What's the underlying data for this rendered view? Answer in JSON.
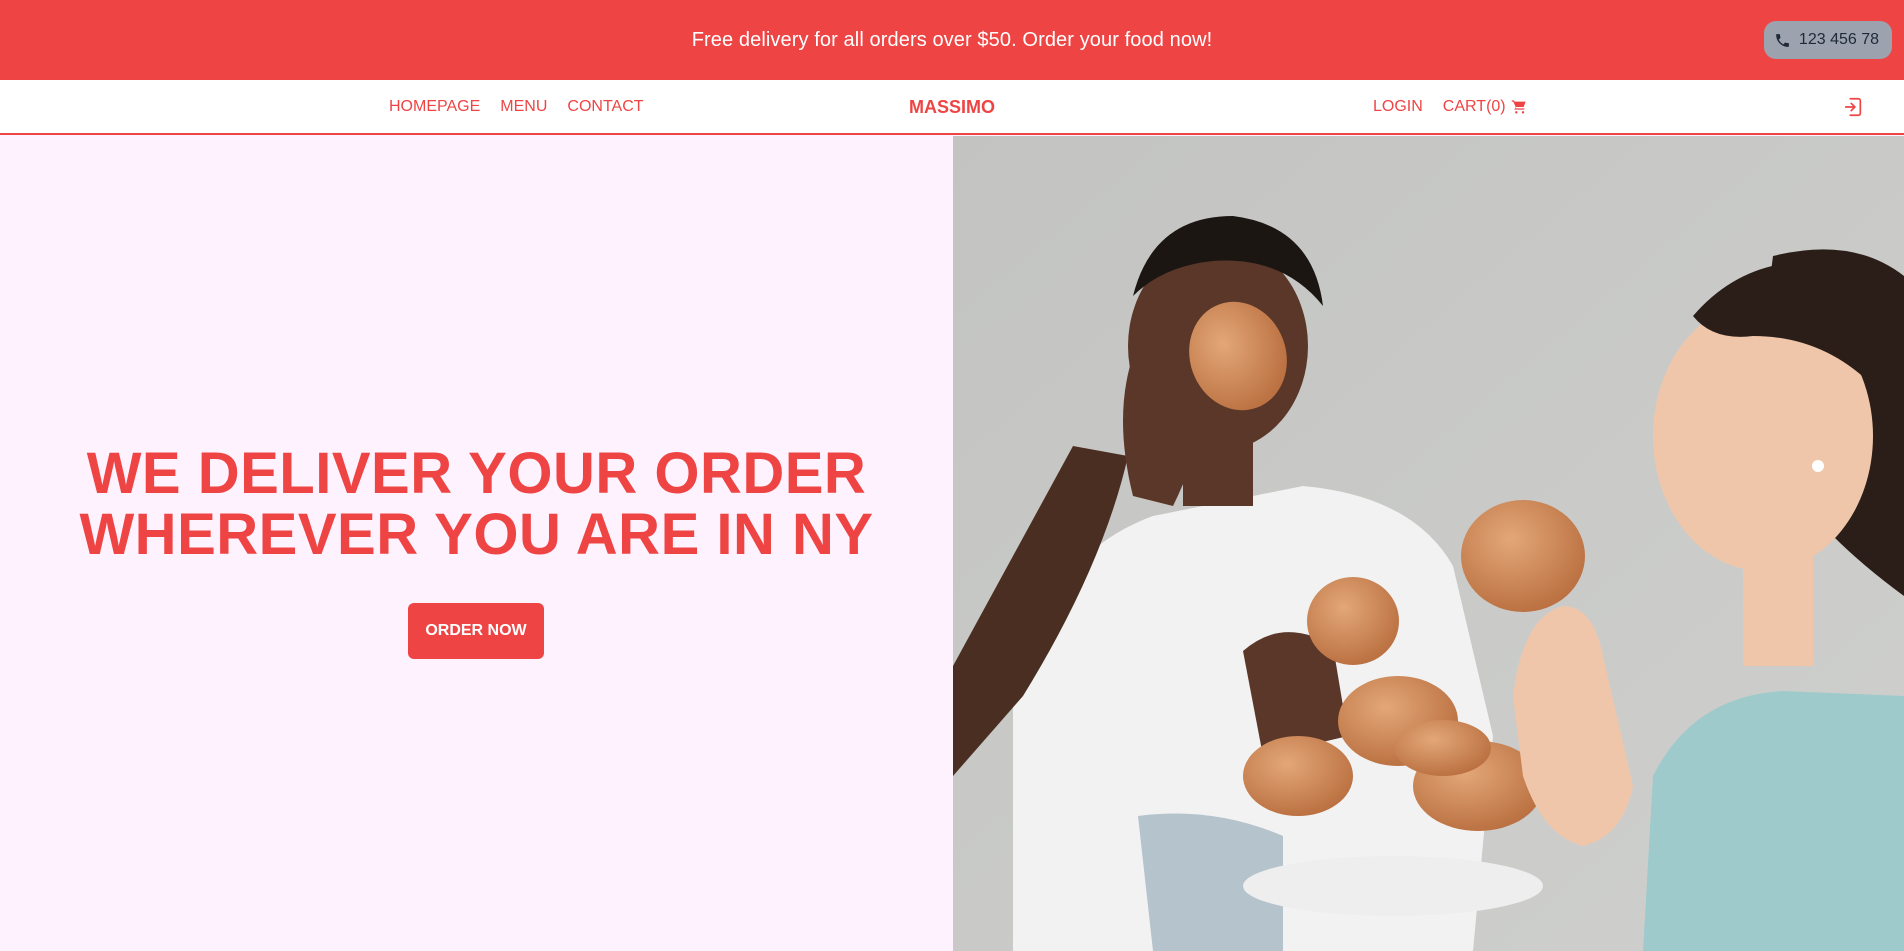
{
  "topbar": {
    "promo": "Free delivery for all orders over $50. Order your food now!",
    "phone": "123 456 78",
    "phone_icon": "phone-icon"
  },
  "nav": {
    "left": [
      "HOMEPAGE",
      "MENU",
      "CONTACT"
    ],
    "brand": "MASSIMO",
    "login": "LOGIN",
    "cart": "CART(0)",
    "cart_icon": "cart-icon",
    "login_icon": "sign-in-icon"
  },
  "hero": {
    "headline_line1": "WE DELIVER YOUR ORDER",
    "headline_line2": "WHEREVER YOU ARE IN NY",
    "cta": "ORDER NOW",
    "image_desc": "two women eating burgers"
  },
  "colors": {
    "accent": "#ef4444",
    "hero_bg": "#fdf2fd",
    "phone_bg": "#9ca3af"
  }
}
